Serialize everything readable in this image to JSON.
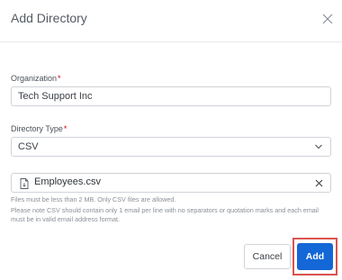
{
  "dialog": {
    "title": "Add Directory",
    "close_icon": "close-icon"
  },
  "organization": {
    "label": "Organization",
    "required_mark": "*",
    "value": "Tech Support Inc"
  },
  "directory_type": {
    "label": "Directory Type",
    "required_mark": "*",
    "selected": "CSV",
    "icon": "chevron-down-icon"
  },
  "file": {
    "name": "Employees.csv",
    "icon": "file-icon",
    "clear_icon": "clear-icon"
  },
  "help": {
    "line1": "Files must be less than 2 MB. Only CSV files are allowed.",
    "line2": "Please note CSV should contain only 1 email per line with no separators or quotation marks and each email must be in valid email address format."
  },
  "footer": {
    "cancel_label": "Cancel",
    "add_label": "Add"
  },
  "colors": {
    "primary": "#1467d6",
    "required": "#d0021b",
    "highlight": "#d9534f"
  }
}
